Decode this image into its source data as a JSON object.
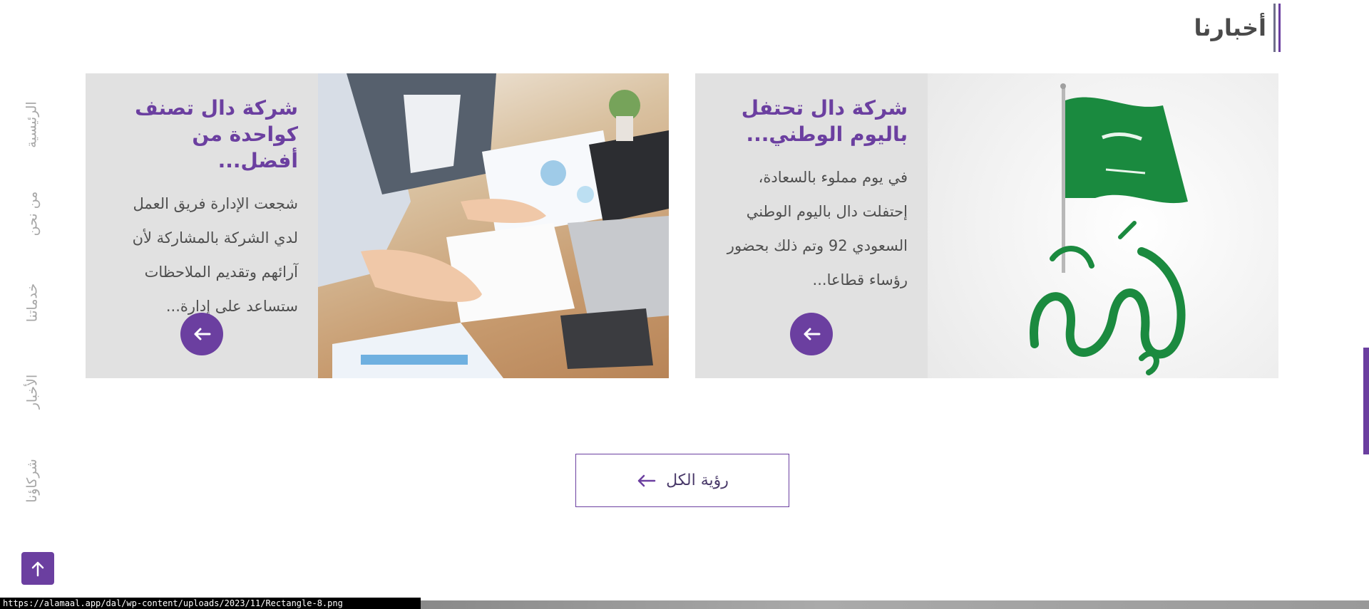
{
  "section": {
    "title": "أخبارنا"
  },
  "side_nav": {
    "items": [
      {
        "label": "الرئيسية"
      },
      {
        "label": "من نحن"
      },
      {
        "label": "خدماتنا"
      },
      {
        "label": "الأخبار"
      },
      {
        "label": "شركاؤنا"
      }
    ]
  },
  "news": [
    {
      "title": "شركة دال تحتفل باليوم الوطني...",
      "body": "في يوم مملوء بالسعادة، إحتفلت دال باليوم الوطني السعودي 92 وتم ذلك بحضور رؤساء قطاعا...",
      "image_icon": "saudi-national-day-flag-image"
    },
    {
      "title": "شركة دال تصنف كواحدة من أفضل...",
      "body": "شجعت الإدارة فريق العمل لدي الشركة بالمشاركة لأن آرائهم وتقديم الملاحظات ستساعد على إدارة...",
      "image_icon": "office-meeting-image"
    }
  ],
  "view_all": {
    "label": "رؤية الكل"
  },
  "status_bar": {
    "url": "https://alamaal.app/dal/wp-content/uploads/2023/11/Rectangle-8.png"
  },
  "colors": {
    "accent": "#6b3fa0",
    "card_bg": "#e1e1e1",
    "text": "#4f4f4f"
  }
}
